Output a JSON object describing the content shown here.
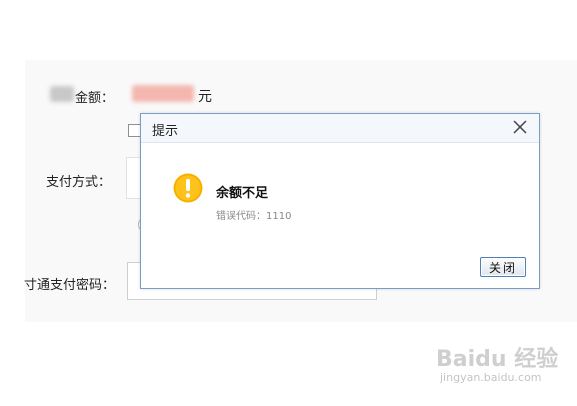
{
  "form": {
    "amount_label": "金额：",
    "amount_unit": "元",
    "payment_method_label": "支付方式：",
    "password_label": "寸通支付密码："
  },
  "dialog": {
    "title": "提示",
    "message": "余额不足",
    "error_code": "错误代码：1110",
    "close_button": "关闭"
  },
  "watermark": {
    "logo": "Baidu 经验",
    "url": "jingyan.baidu.com"
  },
  "colors": {
    "dialog_border": "#7a9cc9",
    "warning_icon": "#f5b000",
    "button_border": "#4e7fb8"
  }
}
